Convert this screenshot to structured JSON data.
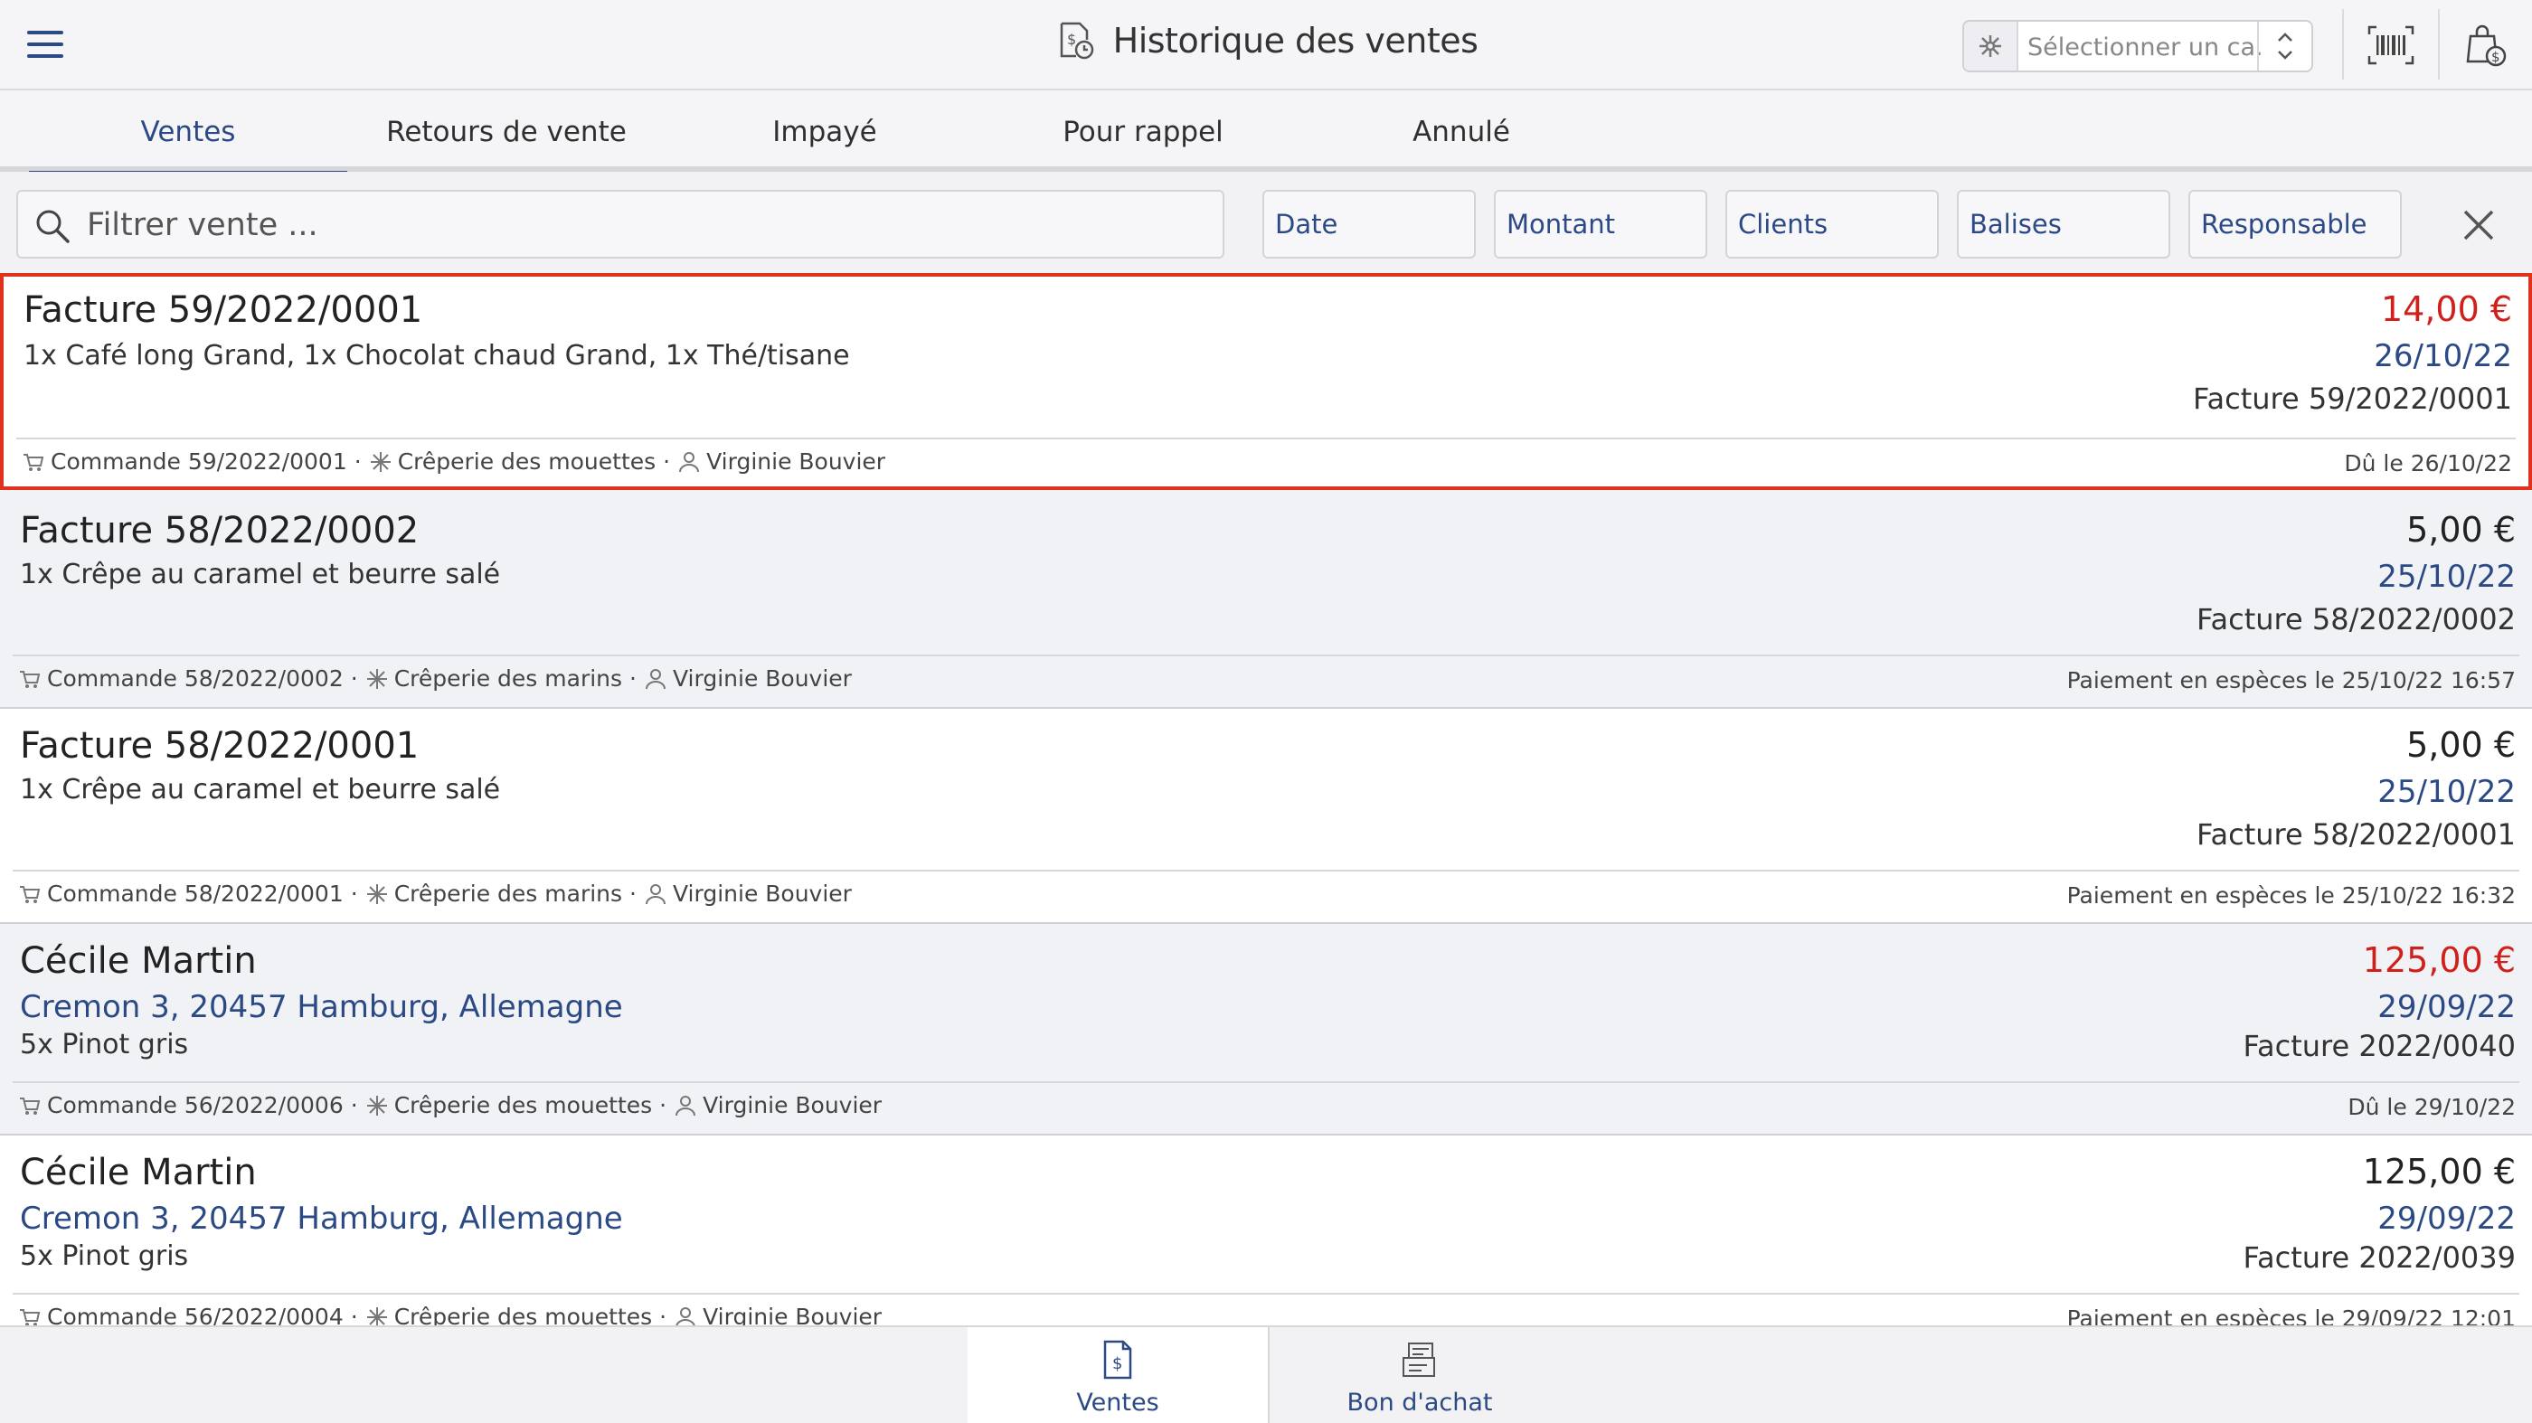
{
  "header": {
    "title": "Historique des ventes",
    "register_placeholder": "Sélectionner un ca.....",
    "icons": [
      "menu-icon",
      "sales-history-icon",
      "register-icon",
      "chevron-updown-icon",
      "barcode-icon",
      "bag-money-icon"
    ]
  },
  "tabs": [
    {
      "label": "Ventes",
      "active": true
    },
    {
      "label": "Retours de vente",
      "active": false
    },
    {
      "label": "Impayé",
      "active": false
    },
    {
      "label": "Pour rappel",
      "active": false
    },
    {
      "label": "Annulé",
      "active": false
    }
  ],
  "filter": {
    "search_placeholder": "Filtrer vente ...",
    "buttons": [
      "Date",
      "Montant",
      "Clients",
      "Balises",
      "Responsable"
    ]
  },
  "sales": [
    {
      "title": "Facture 59/2022/0001",
      "items": "1x Café long Grand, 1x Chocolat chaud Grand, 1x Thé/tisane",
      "amount": "14,00 €",
      "amount_color": "#d0201b",
      "date": "26/10/22",
      "invoice_ref": "Facture 59/2022/0001",
      "order": "Commande 59/2022/0001",
      "register": "Crêperie des mouettes",
      "user": "Virginie Bouvier",
      "status": "Dû le 26/10/22",
      "selected": true
    },
    {
      "title": "Facture 58/2022/0002",
      "items": "1x Crêpe au caramel et beurre salé",
      "amount": "5,00 €",
      "date": "25/10/22",
      "invoice_ref": "Facture 58/2022/0002",
      "order": "Commande 58/2022/0002",
      "register": "Crêperie des marins",
      "user": "Virginie Bouvier",
      "status": "Paiement en espèces le 25/10/22 16:57"
    },
    {
      "title": "Facture 58/2022/0001",
      "items": "1x Crêpe au caramel et beurre salé",
      "amount": "5,00 €",
      "date": "25/10/22",
      "invoice_ref": "Facture 58/2022/0001",
      "order": "Commande 58/2022/0001",
      "register": "Crêperie des marins",
      "user": "Virginie Bouvier",
      "status": "Paiement en espèces le 25/10/22 16:32"
    },
    {
      "title": "Cécile Martin",
      "address": "Cremon 3, 20457 Hamburg, Allemagne",
      "items": "5x Pinot gris",
      "amount": "125,00 €",
      "amount_color": "#d0201b",
      "date": "29/09/22",
      "invoice_ref": "Facture 2022/0040",
      "order": "Commande 56/2022/0006",
      "register": "Crêperie des mouettes",
      "user": "Virginie Bouvier",
      "status": "Dû le 29/10/22"
    },
    {
      "title": "Cécile Martin",
      "address": "Cremon 3, 20457 Hamburg, Allemagne",
      "items": "5x Pinot gris",
      "amount": "125,00 €",
      "date": "29/09/22",
      "invoice_ref": "Facture 2022/0039",
      "order": "Commande 56/2022/0004",
      "register": "Crêperie des mouettes",
      "user": "Virginie Bouvier",
      "status": "Paiement en espèces le 29/09/22 12:01"
    }
  ],
  "bottom_tabs": [
    {
      "label": "Ventes",
      "active": true,
      "icon": "receipt-dollar-icon"
    },
    {
      "label": "Bon d'achat",
      "active": false,
      "icon": "voucher-icon"
    }
  ]
}
